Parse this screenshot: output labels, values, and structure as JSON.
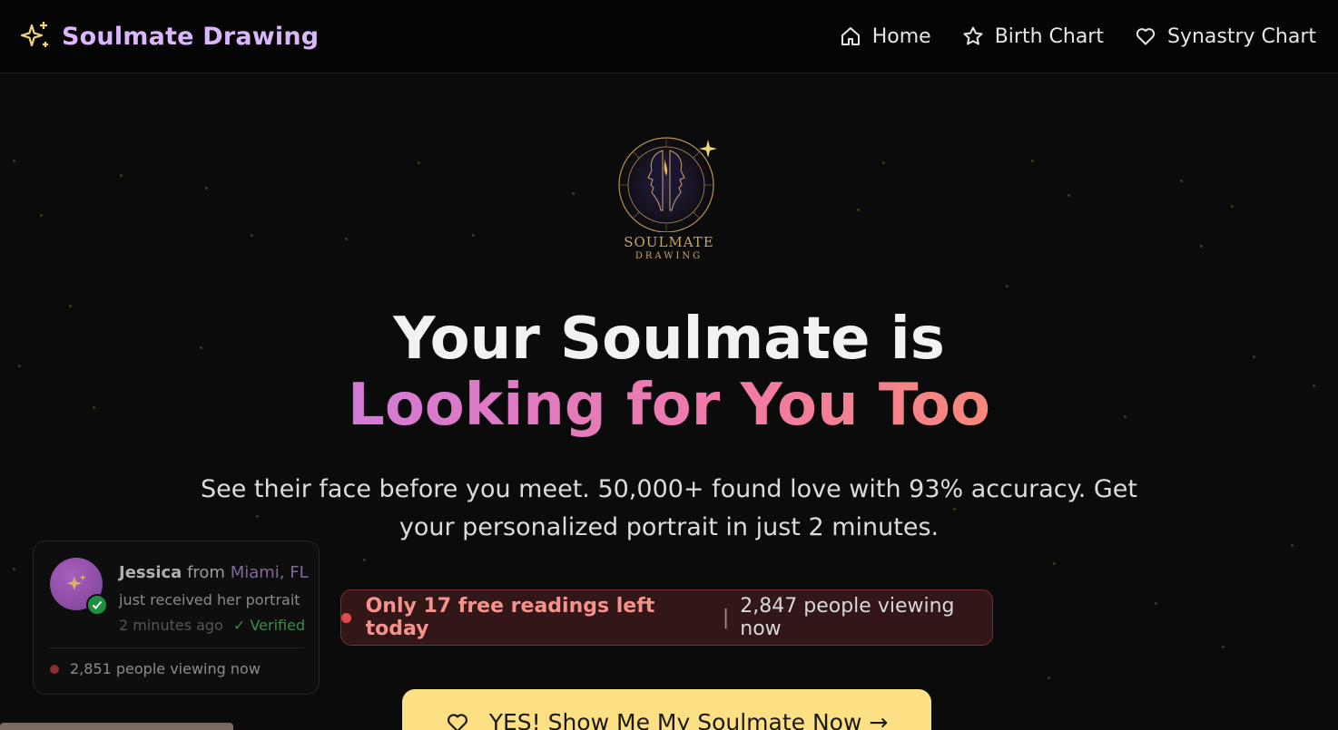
{
  "brand": {
    "name": "Soulmate Drawing",
    "logo_line1": "SOULMATE",
    "logo_line2": "DRAWING"
  },
  "nav": {
    "home": "Home",
    "birth_chart": "Birth Chart",
    "synastry_chart": "Synastry Chart"
  },
  "hero": {
    "title_line1": "Your Soulmate is",
    "title_line2": "Looking for You Too",
    "subtitle": "See their face before you meet. 50,000+ found love with 93% accuracy. Get your personalized portrait in just 2 minutes."
  },
  "urgency": {
    "left": "Only 17 free readings left today",
    "separator": "|",
    "right": "2,847 people viewing now"
  },
  "cta": {
    "label": "YES! Show Me My Soulmate Now →"
  },
  "toast": {
    "name": "Jessica",
    "from": "from",
    "location": "Miami, FL",
    "message": "just received her portrait",
    "time": "2 minutes ago",
    "verified": "✓ Verified",
    "viewing": "2,851 people viewing now"
  },
  "colors": {
    "background": "#0b0b0c",
    "brand_text": "#dcb6fb",
    "brand_star": "#f2d57a",
    "cta_bg": "#fde083",
    "urgency_bg": "#331617",
    "urgency_text": "#f5928c",
    "gradient_start": "#b678f2",
    "gradient_end": "#f8974f"
  },
  "icons": {
    "brand": "sparkles-icon",
    "home": "home-icon",
    "birth_chart": "star-icon",
    "synastry_chart": "heart-icon",
    "cta": "heart-icon",
    "avatar": "sparkles-icon",
    "avatar_badge": "check-icon"
  }
}
